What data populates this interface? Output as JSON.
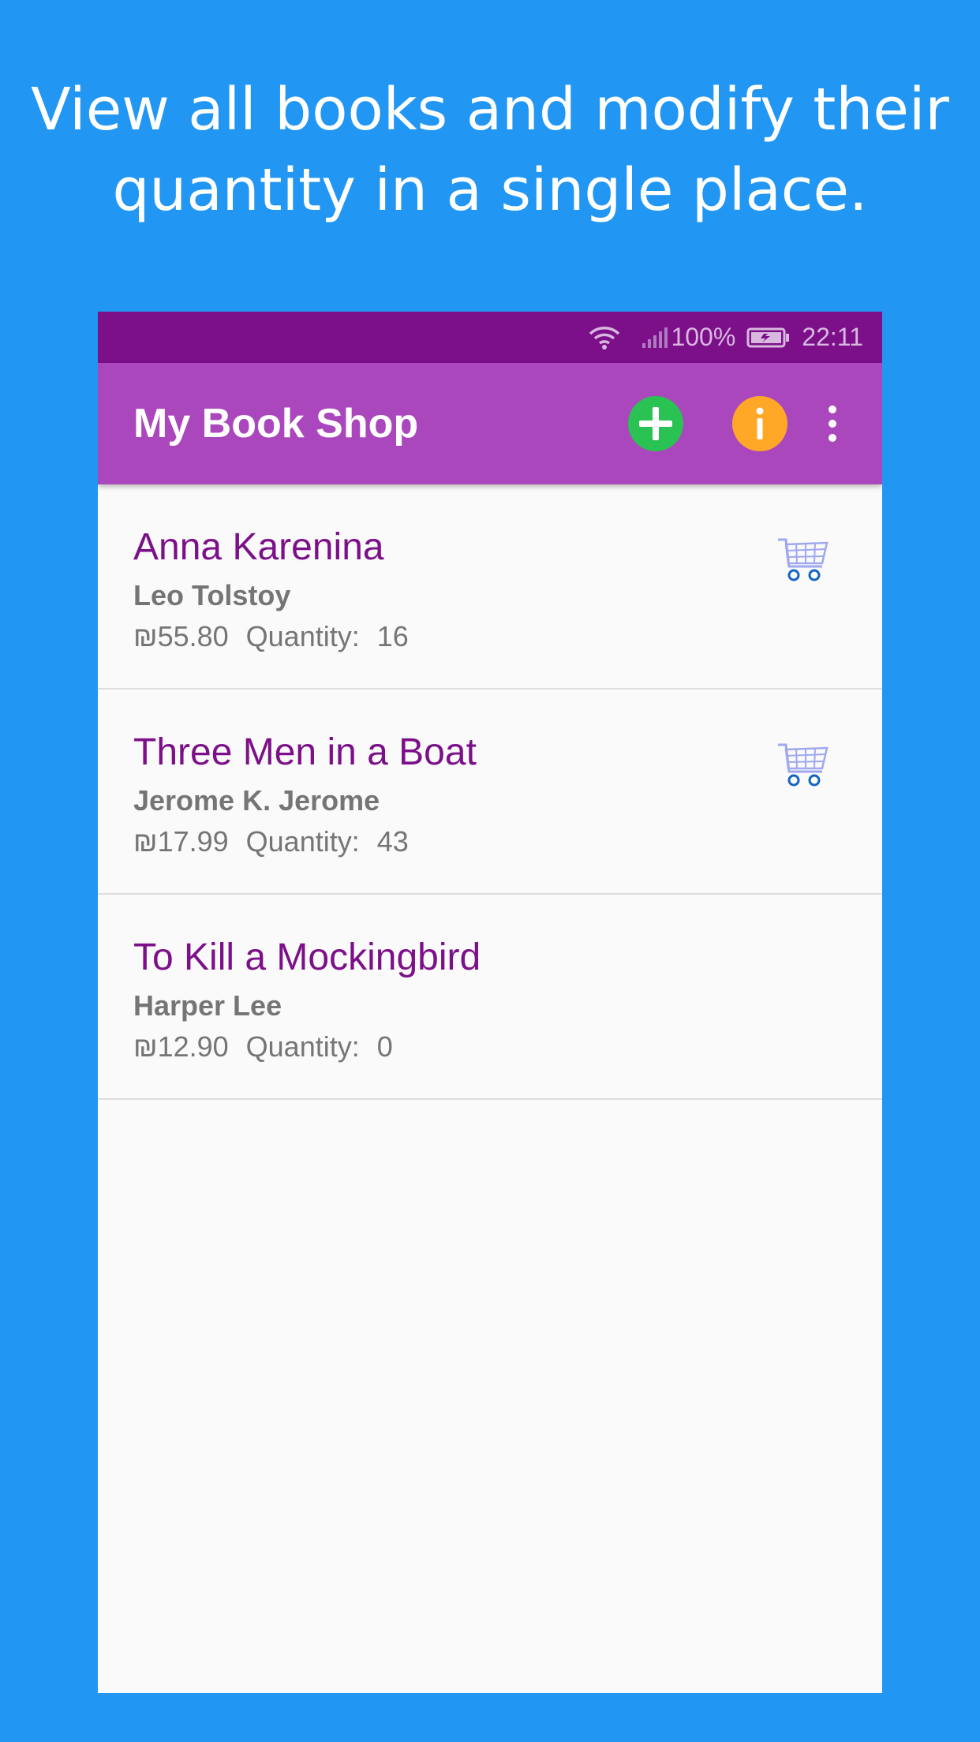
{
  "headline": {
    "line1": "View all books and modify their",
    "line2": "quantity in a single place."
  },
  "statusbar": {
    "battery_percent": "100%",
    "time": "22:11"
  },
  "appbar": {
    "title": "My Book Shop",
    "icons": [
      "plus-icon",
      "info-icon",
      "more-vertical-icon"
    ]
  },
  "colors": {
    "background": "#2196F3",
    "status_bar": "#7B1089",
    "app_bar": "#AB47BC",
    "book_title": "#7B1089",
    "add_button": "#2AC252",
    "info_button": "#FFA726"
  },
  "books": [
    {
      "title": "Anna Karenina",
      "author": "Leo Tolstoy",
      "price": "₪55.80",
      "quantity_label": "Quantity:",
      "quantity": "16",
      "cart_icon": true
    },
    {
      "title": "Three Men in a Boat",
      "author": "Jerome K. Jerome",
      "price": "₪17.99",
      "quantity_label": "Quantity:",
      "quantity": "43",
      "cart_icon": true
    },
    {
      "title": "To Kill a Mockingbird",
      "author": "Harper Lee",
      "price": "₪12.90",
      "quantity_label": "Quantity:",
      "quantity": "0",
      "cart_icon": false
    }
  ]
}
